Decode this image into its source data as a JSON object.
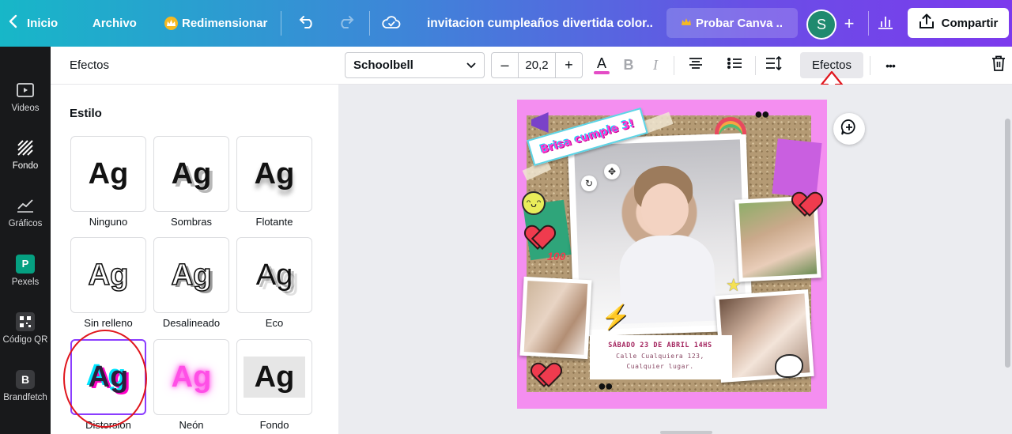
{
  "topbar": {
    "back_label": "Inicio",
    "file_label": "Archivo",
    "resize_label": "Redimensionar",
    "doc_title": "invitacion cumpleaños divertida color..",
    "probar_label": "Probar Canva ..",
    "avatar_initial": "S",
    "share_label": "Compartir"
  },
  "rail": {
    "items": [
      {
        "label": "Videos",
        "icon": "video-icon"
      },
      {
        "label": "Fondo",
        "icon": "background-pattern-icon"
      },
      {
        "label": "Gráficos",
        "icon": "chart-line-icon"
      },
      {
        "label": "Pexels",
        "icon": "pexels-icon"
      },
      {
        "label": "Código QR",
        "icon": "qr-code-icon"
      },
      {
        "label": "Brandfetch",
        "icon": "brandfetch-icon"
      }
    ]
  },
  "panel": {
    "title": "Efectos",
    "section_title": "Estilo",
    "sample_text": "Ag",
    "styles": [
      {
        "label": "Ninguno"
      },
      {
        "label": "Sombras"
      },
      {
        "label": "Flotante"
      },
      {
        "label": "Sin relleno"
      },
      {
        "label": "Desalineado"
      },
      {
        "label": "Eco"
      },
      {
        "label": "Distorsión",
        "selected": true
      },
      {
        "label": "Neón"
      },
      {
        "label": "Fondo"
      }
    ]
  },
  "toolbar": {
    "font_name": "Schoolbell",
    "font_size": "20,2",
    "decrease_label": "–",
    "increase_label": "+",
    "color_letter": "A",
    "bold_letter": "B",
    "italic_letter": "I",
    "effects_label": "Efectos",
    "more_label": "•••",
    "text_color": "#e44cc6"
  },
  "design": {
    "banner_text": "Brisa cumple 3!",
    "date_line": "SÁBADO 23 DE ABRIL 14HS",
    "address_line": "Calle Cualquiera 123,",
    "place_line": "Cualquier lugar.",
    "sticker_hundred": "100",
    "background_color": "#f48ef0"
  },
  "colors": {
    "accent": "#8b3dff",
    "annotation_red": "#e0161d"
  }
}
